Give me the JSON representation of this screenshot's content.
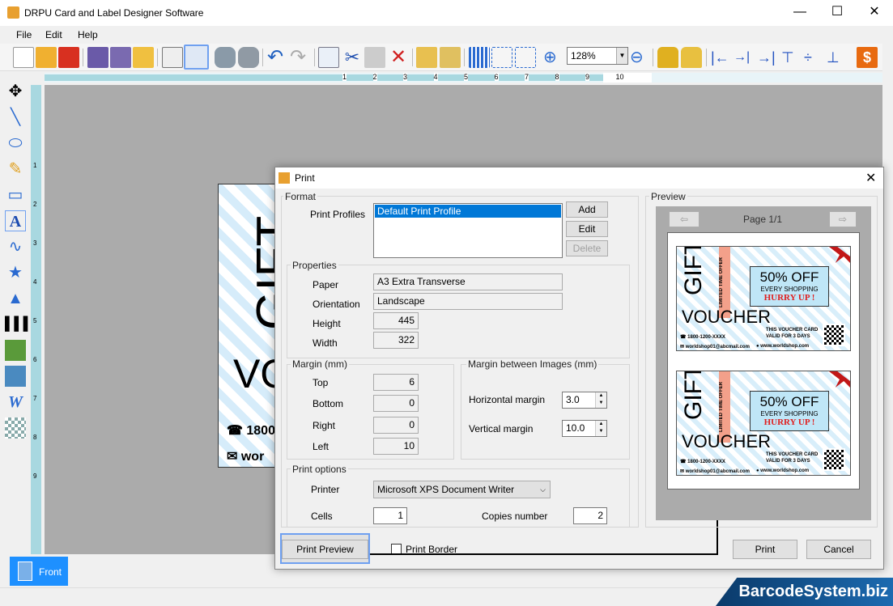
{
  "window": {
    "title": "DRPU Card and Label Designer Software",
    "min": "—",
    "max": "☐",
    "close": "✕"
  },
  "menu": [
    "File",
    "Edit",
    "Help"
  ],
  "toolbar": {
    "zoom": "128%"
  },
  "ruler": [
    "1",
    "2",
    "3",
    "4",
    "5",
    "6",
    "7",
    "8",
    "9",
    "10"
  ],
  "vruler": [
    "1",
    "2",
    "3",
    "4",
    "5",
    "6",
    "7",
    "8",
    "9"
  ],
  "bottom": {
    "tab": "Front",
    "brand": "BarcodeSystem.biz"
  },
  "bigcard": {
    "gift": "GIFT",
    "vo": "VO",
    "phone": "1800",
    "email": "wor"
  },
  "dialog": {
    "title": "Print",
    "close": "✕",
    "format": {
      "legend": "Format",
      "profiles_label": "Print Profiles",
      "profiles": [
        "Default Print Profile"
      ],
      "add": "Add",
      "edit": "Edit",
      "delete": "Delete"
    },
    "properties": {
      "legend": "Properties",
      "paper_label": "Paper",
      "paper": "A3 Extra Transverse",
      "orientation_label": "Orientation",
      "orientation": "Landscape",
      "height_label": "Height",
      "height": "445",
      "width_label": "Width",
      "width": "322"
    },
    "margin": {
      "legend": "Margin (mm)",
      "top_label": "Top",
      "top": "6",
      "bottom_label": "Bottom",
      "bottom": "0",
      "right_label": "Right",
      "right": "0",
      "left_label": "Left",
      "left": "10"
    },
    "between": {
      "legend": "Margin between Images (mm)",
      "h_label": "Horizontal margin",
      "h": "3.0",
      "v_label": "Vertical margin",
      "v": "10.0"
    },
    "print_options": {
      "legend": "Print options",
      "printer_label": "Printer",
      "printer": "Microsoft XPS Document Writer",
      "cells_label": "Cells",
      "cells": "1",
      "copies_label": "Copies number",
      "copies": "2"
    },
    "print_preview": "Print Preview",
    "print_border": "Print Border",
    "print_border_checked": false,
    "print": "Print",
    "cancel": "Cancel",
    "preview": {
      "legend": "Preview",
      "page": "Page 1/1"
    }
  },
  "card": {
    "gift": "GIFT",
    "ribbon": "LIMITED TIME OFFER",
    "off": "50% OFF",
    "every": "EVERY SHOPPING",
    "hurry": "HURRY UP !",
    "voucher": "VOUCHER",
    "phone": "☎ 1800-1200-XXXX",
    "email": "✉ worldshop01@abcmail.com",
    "valid1": "THIS VOUCHER CARD",
    "valid2": "VALID FOR 3 DAYS",
    "web": "● www.worldshop.com"
  }
}
